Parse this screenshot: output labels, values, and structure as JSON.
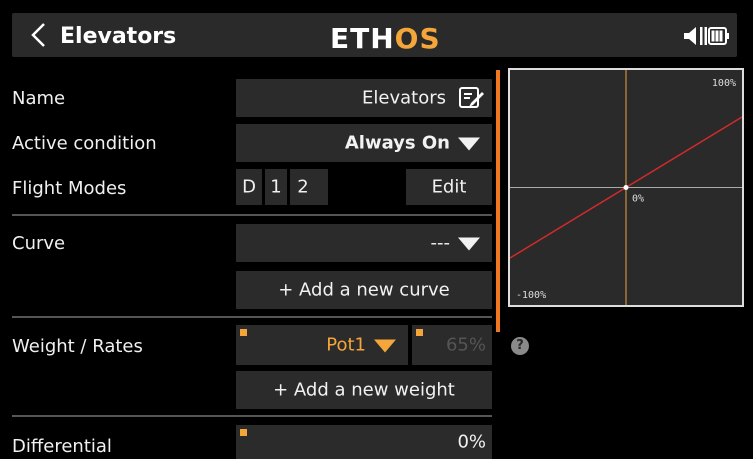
{
  "header": {
    "title": "Elevators",
    "logo_main": "ETH",
    "logo_accent": "OS",
    "back_icon": "chevron-left-icon",
    "battery_icon": "battery-icon"
  },
  "form": {
    "name": {
      "label": "Name",
      "value": "Elevators",
      "icon": "edit-icon"
    },
    "active_condition": {
      "label": "Active condition",
      "value": "Always On"
    },
    "flight_modes": {
      "label": "Flight Modes",
      "modes": [
        "D",
        "1",
        "2"
      ],
      "edit_label": "Edit"
    },
    "curve": {
      "label": "Curve",
      "value": "---",
      "add_label": "+ Add a new curve"
    },
    "weight": {
      "label": "Weight / Rates",
      "source": "Pot1",
      "value": "65%",
      "add_label": "+ Add a new weight"
    },
    "differential": {
      "label": "Differential",
      "value": "0%"
    }
  },
  "chart_data": {
    "type": "line",
    "x": [
      -100,
      100
    ],
    "series": [
      {
        "values": [
          -60,
          60
        ]
      }
    ],
    "xlim": [
      -100,
      100
    ],
    "ylim": [
      -100,
      100
    ],
    "labels": {
      "top_right": "100%",
      "bottom_left": "-100%",
      "center": "0%"
    },
    "colors": {
      "line": "#d22a2a",
      "axis_v": "#e8a33a",
      "axis_h": "#aaaaaa"
    }
  },
  "colors": {
    "accent": "#f4a63a",
    "scroll": "#f07820"
  }
}
